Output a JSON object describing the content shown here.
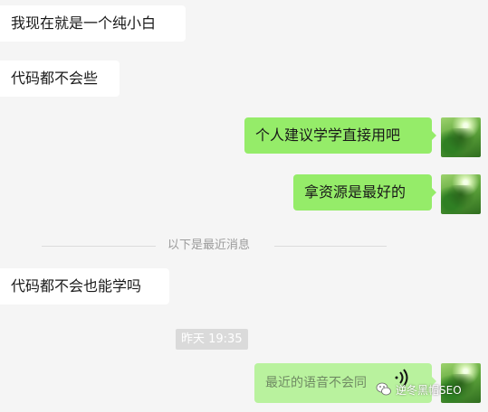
{
  "messages": [
    {
      "side": "in",
      "text": "我现在就是一个纯小白"
    },
    {
      "side": "in",
      "text": "代码都不会些"
    },
    {
      "side": "out",
      "text": "个人建议学学直接用吧"
    },
    {
      "side": "out",
      "text": "拿资源是最好的"
    },
    {
      "side": "in",
      "text": "代码都不会也能学吗"
    },
    {
      "side": "out",
      "type": "voice",
      "text": "最近的语音不会同"
    }
  ],
  "divider": {
    "text": "以下是最近消息"
  },
  "timestamp": "昨天 19:35",
  "watermark": {
    "text": "逆冬黑帽SEO"
  },
  "icons": [
    "forest-avatar-icon",
    "voice-wave-icon",
    "wechat-logo-icon"
  ],
  "colors": {
    "background": "#f5f5f5",
    "incoming": "#ffffff",
    "outgoing": "#95ec69"
  }
}
